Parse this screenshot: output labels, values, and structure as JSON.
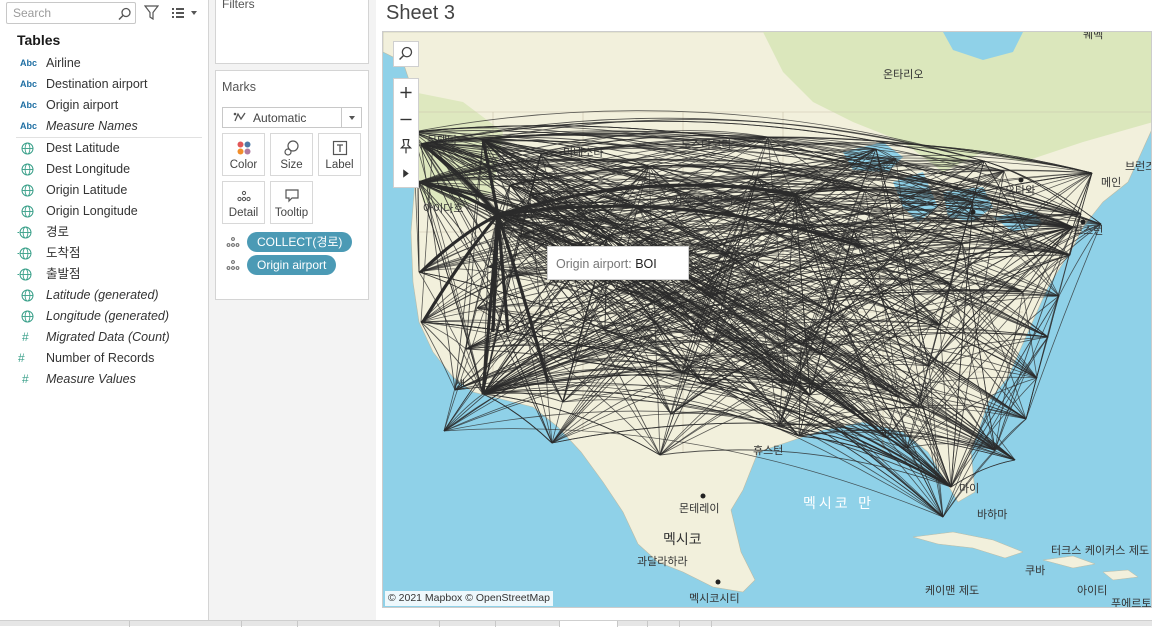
{
  "search": {
    "placeholder": "Search"
  },
  "tables_heading": "Tables",
  "fields": [
    {
      "icon": "abc",
      "label": "Airline",
      "italic": false
    },
    {
      "icon": "abc",
      "label": "Destination airport",
      "italic": false
    },
    {
      "icon": "abc",
      "label": "Origin airport",
      "italic": false
    },
    {
      "icon": "abc",
      "label": "Measure Names",
      "italic": true
    },
    {
      "icon": "globe",
      "label": "Dest Latitude",
      "italic": false
    },
    {
      "icon": "globe",
      "label": "Dest Longitude",
      "italic": false
    },
    {
      "icon": "globe",
      "label": "Origin Latitude",
      "italic": false
    },
    {
      "icon": "globe",
      "label": "Origin Longitude",
      "italic": false
    },
    {
      "icon": "globe-link",
      "label": "경로",
      "italic": false
    },
    {
      "icon": "globe-link",
      "label": "도착점",
      "italic": false
    },
    {
      "icon": "globe-link",
      "label": "출발점",
      "italic": false
    },
    {
      "icon": "globe",
      "label": "Latitude (generated)",
      "italic": true
    },
    {
      "icon": "globe",
      "label": "Longitude (generated)",
      "italic": true
    },
    {
      "icon": "hash",
      "label": "Migrated Data (Count)",
      "italic": true
    },
    {
      "icon": "hash-link",
      "label": "Number of Records",
      "italic": false
    },
    {
      "icon": "hash",
      "label": "Measure Values",
      "italic": true
    }
  ],
  "field_icon_text": {
    "abc": "Abc",
    "hash": "#"
  },
  "filters_title": "Filters",
  "marks": {
    "title": "Marks",
    "type": "Automatic",
    "buttons": [
      "Color",
      "Size",
      "Label",
      "Detail",
      "Tooltip"
    ],
    "pills": [
      "COLLECT(경로)",
      "Origin airport"
    ]
  },
  "sheet_title": "Sheet 3",
  "tooltip": {
    "field": "Origin airport:",
    "value": "BOI"
  },
  "attribution": "© 2021 Mapbox © OpenStreetMap",
  "map_labels": [
    "온타리오",
    "노스다코타",
    "미네소타",
    "몬태나",
    "아이다호",
    "사우스다코타",
    "오타와",
    "메인",
    "브런즈",
    "보스턴",
    "샌",
    "멕시코 만",
    "멕시코",
    "몬테레이",
    "과달라하라",
    "멕시코시티",
    "마이",
    "바하마",
    "터크스 케이커스 제도",
    "쿠바",
    "케이맨 제도",
    "아이티",
    "푸에르토",
    "휴스턴",
    "퀘벡"
  ],
  "colors": {
    "water": "#8fd1e8",
    "land": "#f2f0dc",
    "land_green": "#d8e6b8",
    "route": "#2b2b2b",
    "pill": "#4b9ab5",
    "field_dim": "#1f6fa3",
    "field_measure": "#3aa08a"
  }
}
